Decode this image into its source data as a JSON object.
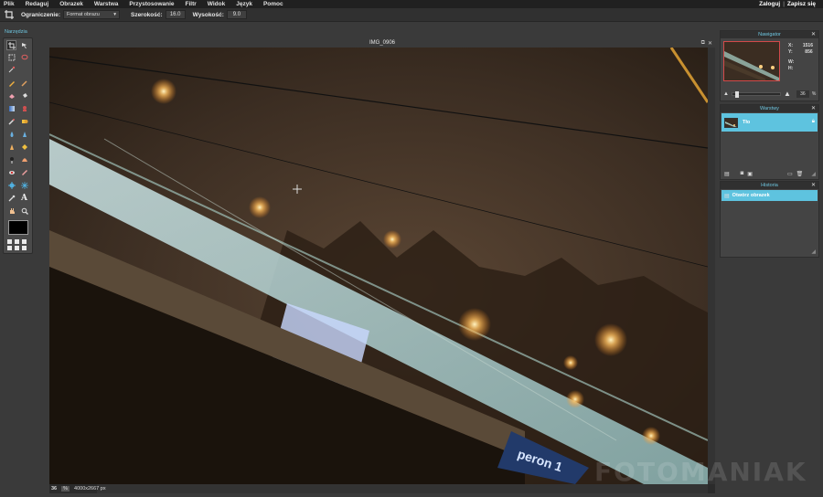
{
  "menubar": {
    "items": [
      "Plik",
      "Redaguj",
      "Obrazek",
      "Warstwa",
      "Przystosowanie",
      "Filtr",
      "Widok",
      "Język",
      "Pomoc"
    ],
    "login": "Zaloguj",
    "separator": "|",
    "register": "Zapisz się"
  },
  "options": {
    "constraint_label": "Ograniczenie:",
    "constraint_value": "Format obrazu",
    "width_label": "Szerokość:",
    "width_value": "16.0",
    "height_label": "Wysokość:",
    "height_value": "9.0"
  },
  "tools": {
    "title": "Narzędzia"
  },
  "document": {
    "title": "IMG_0906",
    "zoom": "36",
    "zoom_unit": "%",
    "dimensions": "4000x2667 px"
  },
  "navigator": {
    "title": "Nawigator",
    "x_label": "X:",
    "x_value": "1516",
    "y_label": "Y:",
    "y_value": "856",
    "w_label": "W:",
    "h_label": "H:",
    "zoom_value": "36",
    "zoom_unit": "%",
    "zoom_fraction": 0.06
  },
  "layers": {
    "title": "Warstwy",
    "items": [
      {
        "name": "Tło"
      }
    ]
  },
  "history": {
    "title": "Historia",
    "items": [
      {
        "label": "Otwórz obrazek"
      }
    ]
  },
  "watermark": "FOTOMANIAK",
  "colors": {
    "accent": "#5ec3df",
    "panel_title": "#6ec6e0",
    "foreground": "#000000"
  }
}
